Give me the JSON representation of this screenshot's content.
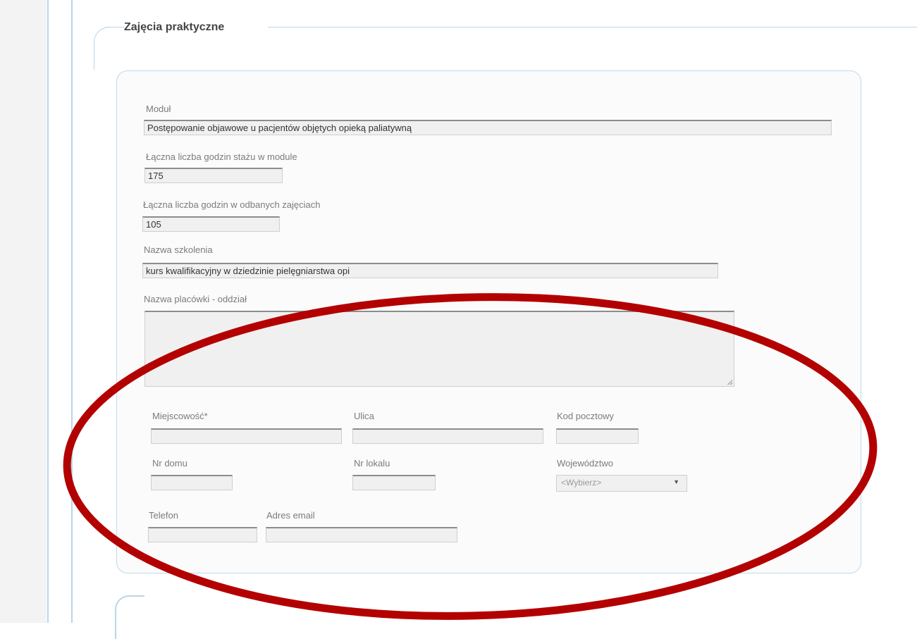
{
  "fieldset": {
    "legend": "Zajęcia praktyczne"
  },
  "form": {
    "modul": {
      "label": "Moduł",
      "value": "Postępowanie objawowe u pacjentów objętych opieką paliatywną"
    },
    "laczna_staz": {
      "label": "Łączna liczba godzin stażu w module",
      "value": "175"
    },
    "laczna_zajecia": {
      "label": "Łączna liczba godzin w odbanych zajęciach",
      "value": "105"
    },
    "nazwa_szkolenia": {
      "label": "Nazwa szkolenia",
      "value": "kurs kwalifikacyjny w dziedzinie pielęgniarstwa opi"
    },
    "placowka": {
      "label": "Nazwa placówki - oddział",
      "value": ""
    },
    "miejscowosc": {
      "label": "Miejscowość*",
      "value": ""
    },
    "ulica": {
      "label": "Ulica",
      "value": ""
    },
    "kod": {
      "label": "Kod pocztowy",
      "value": ""
    },
    "nr_domu": {
      "label": "Nr domu",
      "value": ""
    },
    "nr_lokalu": {
      "label": "Nr lokalu",
      "value": ""
    },
    "wojewodztwo": {
      "label": "Województwo",
      "value": "<Wybierz>"
    },
    "telefon": {
      "label": "Telefon",
      "value": ""
    },
    "email": {
      "label": "Adres email",
      "value": ""
    }
  },
  "colors": {
    "border_accent": "#b9d6ea",
    "annotation": "#b30000"
  }
}
